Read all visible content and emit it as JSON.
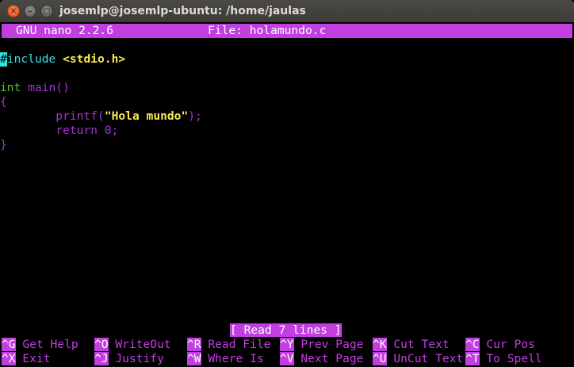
{
  "window": {
    "title": "josemlp@josemlp-ubuntu: /home/jaulas",
    "close_glyph": "✕",
    "minimize_glyph": "–",
    "maximize_glyph": "□"
  },
  "nano": {
    "version": "GNU nano 2.2.6",
    "file": "File: holamundo.c",
    "status": "[ Read 7 lines ]"
  },
  "editor": {
    "lines": [
      {
        "cursor": "#",
        "keyword": "include",
        "space": " ",
        "header": "<stdio.h>"
      },
      {
        "text": ""
      },
      {
        "type": "int",
        "rest": " main()"
      },
      {
        "text": "{"
      },
      {
        "indent": "        ",
        "func": "printf(",
        "string": "\"Hola mundo\"",
        "end": ");"
      },
      {
        "indent": "        ",
        "stmt": "return 0;"
      },
      {
        "text": "}"
      }
    ]
  },
  "shortcuts": {
    "row1": [
      {
        "key": "^G",
        "label": " Get Help"
      },
      {
        "key": "^O",
        "label": " WriteOut"
      },
      {
        "key": "^R",
        "label": " Read File"
      },
      {
        "key": "^Y",
        "label": " Prev Page"
      },
      {
        "key": "^K",
        "label": " Cut Text"
      },
      {
        "key": "^C",
        "label": " Cur Pos"
      }
    ],
    "row2": [
      {
        "key": "^X",
        "label": " Exit"
      },
      {
        "key": "^J",
        "label": " Justify"
      },
      {
        "key": "^W",
        "label": " Where Is"
      },
      {
        "key": "^V",
        "label": " Next Page"
      },
      {
        "key": "^U",
        "label": " UnCut Text"
      },
      {
        "key": "^T",
        "label": " To Spell"
      }
    ]
  },
  "colors": {
    "nano_accent": "#c23ee0",
    "keyword_cyan": "#34e2e2",
    "type_green": "#55c233",
    "string_yellow": "#fce94f",
    "code_purple": "#a533cc",
    "close_button": "#df4b16",
    "titlebar": "#3c3b37"
  }
}
